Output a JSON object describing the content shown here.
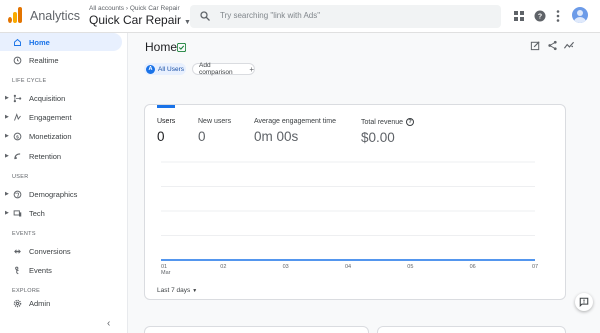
{
  "header": {
    "app_name": "Analytics",
    "breadcrumb": "All accounts › Quick Car Repair",
    "property_name": "Quick Car Repair",
    "search_placeholder": "Try searching \"link with Ads\""
  },
  "sidebar": {
    "items": [
      {
        "label": "Home",
        "icon": "home-icon",
        "active": true
      },
      {
        "label": "Realtime",
        "icon": "clock-icon"
      }
    ],
    "sections": [
      {
        "title": "LIFE CYCLE",
        "items": [
          {
            "label": "Acquisition",
            "icon": "acquisition-icon"
          },
          {
            "label": "Engagement",
            "icon": "engagement-icon"
          },
          {
            "label": "Monetization",
            "icon": "monetization-icon"
          },
          {
            "label": "Retention",
            "icon": "retention-icon"
          }
        ]
      },
      {
        "title": "USER",
        "items": [
          {
            "label": "Demographics",
            "icon": "globe-icon"
          },
          {
            "label": "Tech",
            "icon": "tech-icon"
          }
        ]
      },
      {
        "title": "EVENTS",
        "items": [
          {
            "label": "Conversions",
            "icon": "conversions-icon"
          },
          {
            "label": "Events",
            "icon": "events-icon"
          }
        ]
      },
      {
        "title": "EXPLORE",
        "items": [
          {
            "label": "Admin",
            "icon": "gear-icon"
          }
        ]
      }
    ]
  },
  "main": {
    "title": "Home",
    "chip_all_users": {
      "avatar": "A",
      "label": "All Users"
    },
    "chip_add_comparison": "Add comparison",
    "date_range": "Last 7 days"
  },
  "metrics": [
    {
      "label": "Users",
      "value": "0"
    },
    {
      "label": "New users",
      "value": "0"
    },
    {
      "label": "Average engagement time",
      "value": "0m 00s"
    },
    {
      "label": "Total revenue",
      "value": "$0.00"
    }
  ],
  "chart_data": {
    "type": "line",
    "x": [
      "01",
      "02",
      "03",
      "04",
      "05",
      "06",
      "07"
    ],
    "x_sublabel": "Mar",
    "series": [
      {
        "values": [
          0,
          0,
          0,
          0,
          0,
          0,
          0
        ]
      }
    ],
    "grid": true,
    "color": "#1a73e8"
  },
  "colors": {
    "accent": "#1a73e8",
    "brand_orange": "#e37400",
    "brand_yellow": "#f9ab00"
  }
}
